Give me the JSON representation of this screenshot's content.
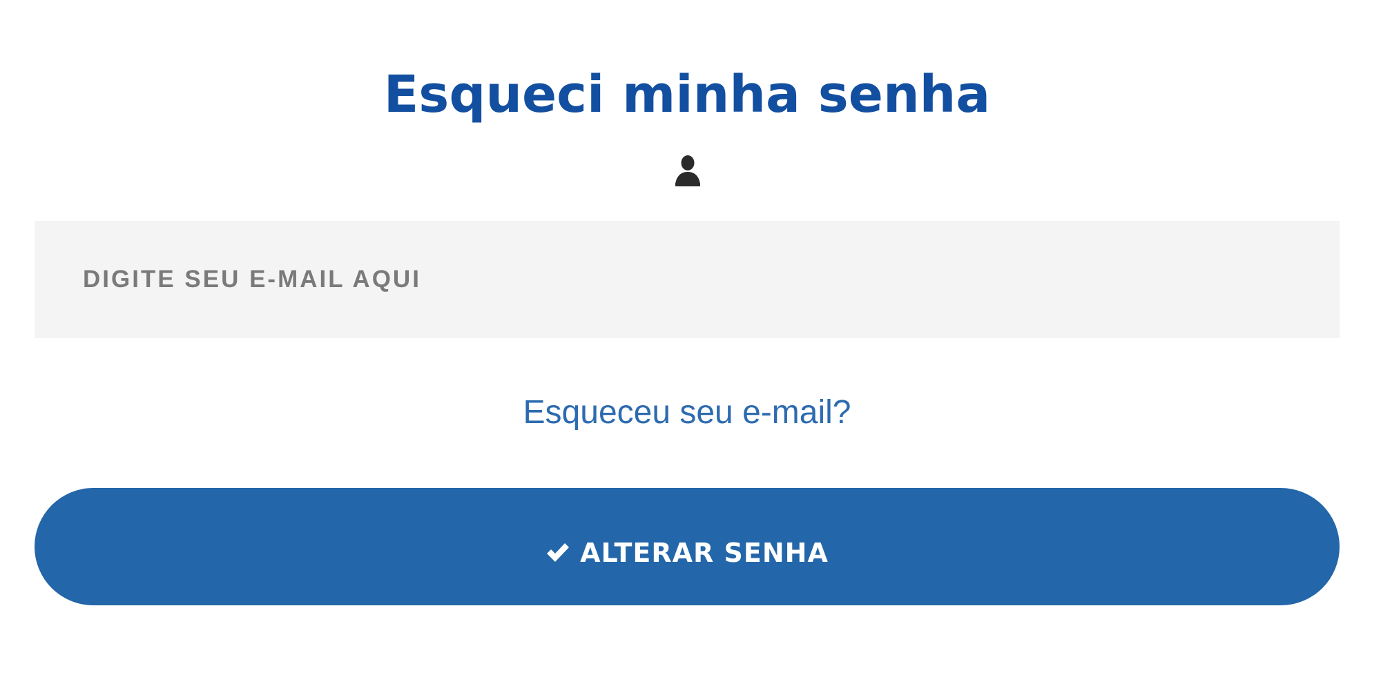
{
  "page": {
    "title": "Esqueci minha senha"
  },
  "icons": {
    "user": "user-icon",
    "check": "check-icon"
  },
  "form": {
    "email": {
      "value": "",
      "placeholder": "DIGITE SEU E-MAIL AQUI"
    },
    "forgot_email_link": "Esqueceu seu e-mail?",
    "submit_label": "ALTERAR SENHA"
  },
  "colors": {
    "title": "#134fa0",
    "link": "#2d6bb0",
    "button_bg": "#2366a9",
    "input_bg": "#f4f4f4",
    "placeholder": "#7a7a7a"
  }
}
